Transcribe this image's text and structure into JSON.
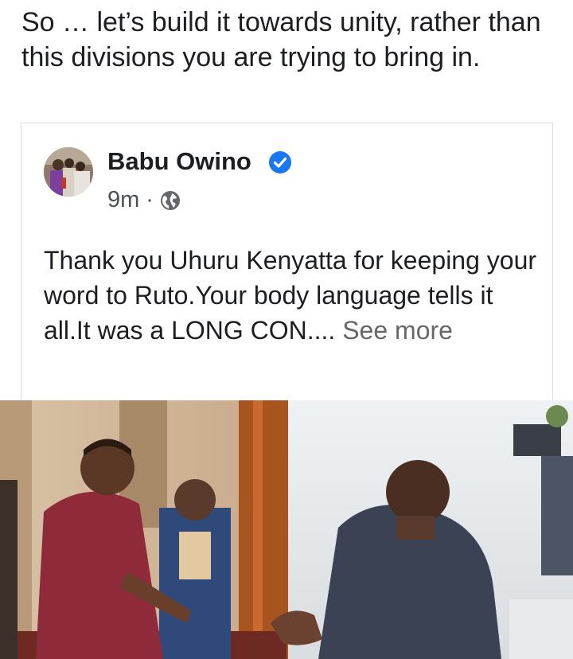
{
  "comment": {
    "text": "So … let’s build it towards unity, rather than this divisions you are trying to bring in."
  },
  "shared_post": {
    "author": "Babu Owino",
    "verified": true,
    "time": "9m",
    "separator": "·",
    "visibility_icon": "globe-icon",
    "body": "Thank you Uhuru Kenyatta for keeping your word to Ruto.Your body language tells it all.It was a LONG CON....",
    "see_more": "See more"
  },
  "colors": {
    "text": "#1c1e21",
    "secondary_text": "#65676b",
    "verified_badge": "#1877f2",
    "card_border": "#dadde1"
  }
}
